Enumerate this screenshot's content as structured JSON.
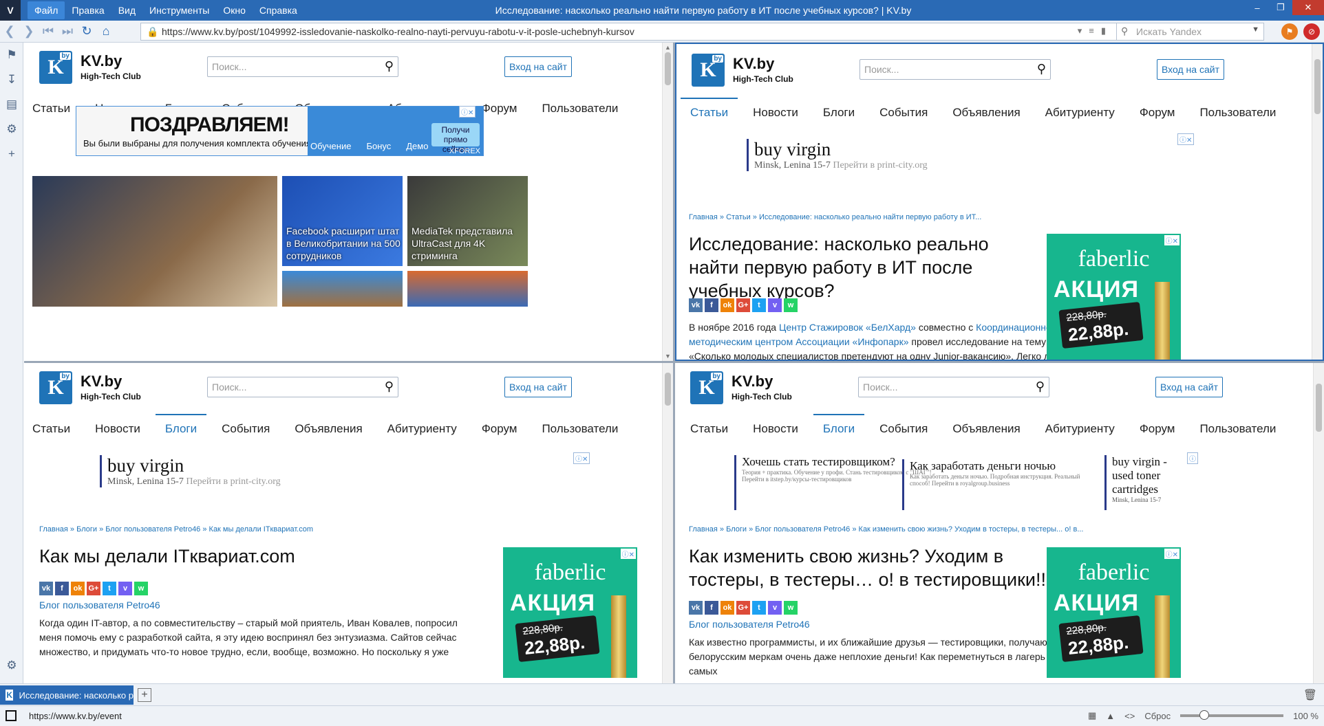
{
  "app": {
    "title": "Исследование: насколько реально найти первую работу в ИТ после учебных курсов? | KV.by",
    "menu": [
      "Файл",
      "Правка",
      "Вид",
      "Инструменты",
      "Окно",
      "Справка"
    ],
    "logo": "V"
  },
  "nav": {
    "url": "https://www.kv.by/post/1049992-issledovanie-naskolko-realno-nayti-pervuyu-rabotu-v-it-posle-uchebnyh-kursov",
    "search_placeholder": "Искать Yandex"
  },
  "site": {
    "brand": "KV.by",
    "brand_sub": "High-Tech Club",
    "logo_letter": "K",
    "logo_badge": "by",
    "search_placeholder": "Поиск...",
    "login": "Вход на сайт",
    "nav": [
      "Статьи",
      "Новости",
      "Блоги",
      "События",
      "Объявления",
      "Абитуриенту",
      "Форум",
      "Пользователи"
    ]
  },
  "ads": {
    "forex_big": "ПОЗДРАВЛЯЕМ!",
    "forex_small": "Вы были выбраны для получения комплекта обучения Форекс",
    "forex_steps": [
      "Обучение",
      "Бонус",
      "Демо"
    ],
    "forex_cta": "Получи прямо сейчас",
    "forex_brand": "XFOREX",
    "virgin_title": "buy virgin",
    "virgin_addr": "Minsk, Lenina 15-7",
    "virgin_link": "Перейти в print-city.org",
    "faberlic_name": "faberlic",
    "faberlic_akcia": "АКЦИЯ",
    "faberlic_old": "228,80р.",
    "faberlic_new": "22,88р.",
    "multi": [
      {
        "title": "Хочешь стать тестировщиком?",
        "text": "Теория + практика. Обучение у профи. Стань тестировщиком с \"ШАГ\"! Перейти в itstep.by/курсы-тестировщиков"
      },
      {
        "title": "Как заработать деньги ночью",
        "text": "Как заработать деньги ночью. Подробная инструкция. Реальный способ! Перейти в royalgroup.business"
      },
      {
        "title": "buy virgin - used toner cartridges",
        "text": "Minsk, Lenina 15-7"
      }
    ]
  },
  "news": [
    {
      "caption": ""
    },
    {
      "caption": "Facebook расширит штат в Великобритании на 500 сотрудников"
    },
    {
      "caption": "MediaTek представила UltraCast для 4K стриминга"
    }
  ],
  "tr": {
    "breadcrumb": "Главная » Статьи » Исследование: насколько реально найти первую работу в ИТ...",
    "title": "Исследование: насколько реально найти первую работу в ИТ после учебных курсов?",
    "body_1": "В ноябре 2016 года ",
    "link_1": "Центр Стажировок «БелХард»",
    "body_2": " совместно с ",
    "link_2": "Координационно-методическим центром Ассоциации «Инфопарк»",
    "body_3": " провел исследование на тему: «Сколько молодых специалистов претендуют на одну Junior-вакансию». Легко ли придется"
  },
  "bl": {
    "breadcrumb": "Главная » Блоги » Блог пользователя Petro46 » Как мы делали ITквариат.com",
    "title": "Как мы делали ITквариат.com",
    "blog": "Блог пользователя Petro46",
    "body": "Когда один IT-автор, а по совместительству – старый мой приятель, Иван Ковалев, попросил меня помочь ему с разработкой сайта, я эту идею воспринял без энтузиазма. Сайтов сейчас множество, и придумать что-то новое трудно, если, вообще, возможно. Но поскольку я уже"
  },
  "br": {
    "breadcrumb": "Главная » Блоги » Блог пользователя Petro46 » Как изменить свою жизнь? Уходим в тостеры, в тестеры... о! в...",
    "title": "Как изменить свою жизнь? Уходим в тостеры, в тестеры… о! в тестировщики!!!",
    "blog": "Блог пользователя Petro46",
    "body": "Как известно программисты, и их ближайшие друзья — тестировщики, получают по белорусским меркам очень даже неплохие деньги! Как переметнуться в лагерь этих самых"
  },
  "share": [
    {
      "label": "vk",
      "color": "#4a76a8"
    },
    {
      "label": "f",
      "color": "#3b5998"
    },
    {
      "label": "ok",
      "color": "#ee8208"
    },
    {
      "label": "G+",
      "color": "#dd4b39"
    },
    {
      "label": "t",
      "color": "#1da1f2"
    },
    {
      "label": "v",
      "color": "#7360f2"
    },
    {
      "label": "w",
      "color": "#25d366"
    }
  ],
  "tabbar": {
    "tab_title": "Исследование: насколько р"
  },
  "status": {
    "url": "https://www.kv.by/event",
    "reset": "Сброс",
    "zoom": "100 %"
  }
}
